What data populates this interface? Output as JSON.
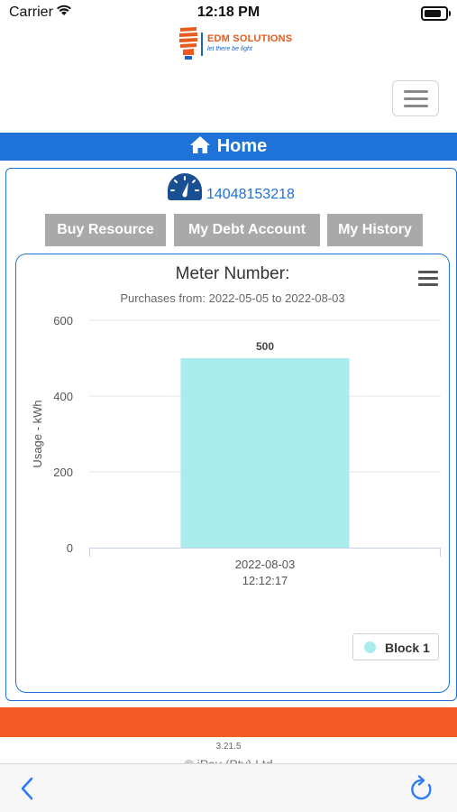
{
  "status_bar": {
    "carrier": "Carrier",
    "time": "12:18 PM"
  },
  "logo": {
    "name": "EDM SOLUTIONS",
    "tagline": "let there be light"
  },
  "home": {
    "label": "Home"
  },
  "meter": {
    "id": "14048153218"
  },
  "buttons": {
    "buy": "Buy Resource",
    "debt": "My Debt Account",
    "history": "My History"
  },
  "footer": {
    "version": "3.21.5",
    "copyright": "© iPay (Pty) Ltd"
  },
  "colors": {
    "brand_blue": "#1f72d8",
    "brand_orange": "#f15a22",
    "bar": "#aaeced",
    "button_gray": "#a9a9a9"
  },
  "icons": {
    "home": "home-icon",
    "gauge": "speedometer-icon",
    "menu": "hamburger-menu-icon",
    "back": "chevron-left-icon",
    "reload": "reload-icon",
    "wifi": "wifi-icon",
    "battery": "battery-icon"
  },
  "chart_data": {
    "type": "bar",
    "title": "Meter Number:",
    "subtitle": "Purchases from: 2022-05-05 to 2022-08-03",
    "ylabel": "Usage - kWh",
    "xlabel": "",
    "categories": [
      [
        "2022-08-03",
        "12:12:17"
      ]
    ],
    "series": [
      {
        "name": "Block 1",
        "values": [
          500
        ],
        "color": "#aaeced"
      }
    ],
    "data_labels": [
      "500"
    ],
    "ylim": [
      0,
      600
    ],
    "yticks": [
      "0",
      "200",
      "400",
      "600"
    ],
    "grid": true,
    "legend_position": "bottom-right"
  }
}
